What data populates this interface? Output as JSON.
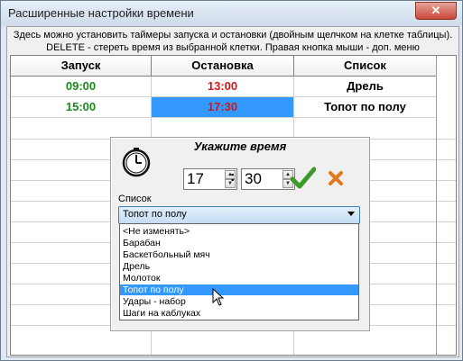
{
  "window": {
    "title": "Расширенные настройки времени",
    "close_label": "✕"
  },
  "info_lines": [
    "Здесь можно установить таймеры запуска и остановки (двойным щелчком на клетке таблицы).",
    "DELETE - стереть время из выбранной клетки. Правая кнопка мыши - доп. меню"
  ],
  "table": {
    "headers": [
      "Запуск",
      "Остановка",
      "Список"
    ],
    "rows": [
      {
        "start": "09:00",
        "stop": "13:00",
        "list": "Дрель"
      },
      {
        "start": "15:00",
        "stop": "17:30",
        "list": "Топот по полу"
      }
    ],
    "colors": {
      "start": "#1a8a1a",
      "stop": "#d01818",
      "selected_cell_bg": "#3399ff"
    }
  },
  "dialog": {
    "title": "Укажите время",
    "hours": "17",
    "minutes": "30",
    "separator": ":",
    "icons": {
      "clock": "clock-icon",
      "ok": "checkmark-icon",
      "cancel": "cross-icon"
    },
    "list_label": "Список",
    "selected_value": "Топот по полу",
    "options": [
      "<Не изменять>",
      "Барабан",
      "Баскетбольный мяч",
      "Дрель",
      "Молоток",
      "Топот по полу",
      "Удары - набор",
      "Шаги на каблуках"
    ],
    "highlighted_index": 5
  }
}
